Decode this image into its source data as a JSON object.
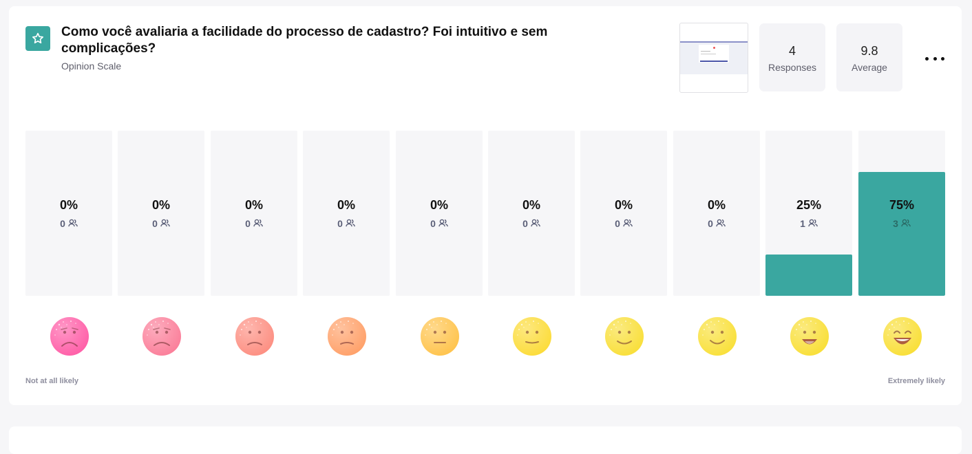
{
  "question": {
    "title": "Como você avaliaria a facilidade do processo de cadastro? Foi intuitivo e sem complicações?",
    "type": "Opinion Scale",
    "icon": "star-icon"
  },
  "stats": {
    "responses_value": "4",
    "responses_label": "Responses",
    "average_value": "9.8",
    "average_label": "Average"
  },
  "scale": {
    "left_label": "Not at all likely",
    "right_label": "Extremely likely",
    "items": [
      {
        "percent_text": "0%",
        "count": "0",
        "fraction": 0.0,
        "color": "#ff5fa8"
      },
      {
        "percent_text": "0%",
        "count": "0",
        "fraction": 0.0,
        "color": "#fb7f9a"
      },
      {
        "percent_text": "0%",
        "count": "0",
        "fraction": 0.0,
        "color": "#fd8f82"
      },
      {
        "percent_text": "0%",
        "count": "0",
        "fraction": 0.0,
        "color": "#ffa16a"
      },
      {
        "percent_text": "0%",
        "count": "0",
        "fraction": 0.0,
        "color": "#ffc44d"
      },
      {
        "percent_text": "0%",
        "count": "0",
        "fraction": 0.0,
        "color": "#fcdc3a"
      },
      {
        "percent_text": "0%",
        "count": "0",
        "fraction": 0.0,
        "color": "#f9df3a"
      },
      {
        "percent_text": "0%",
        "count": "0",
        "fraction": 0.0,
        "color": "#f9e03a"
      },
      {
        "percent_text": "25%",
        "count": "1",
        "fraction": 0.25,
        "color": "#f9df38"
      },
      {
        "percent_text": "75%",
        "count": "3",
        "fraction": 0.75,
        "color": "#f9df38"
      }
    ]
  },
  "colors": {
    "accent": "#3aa7a0"
  }
}
